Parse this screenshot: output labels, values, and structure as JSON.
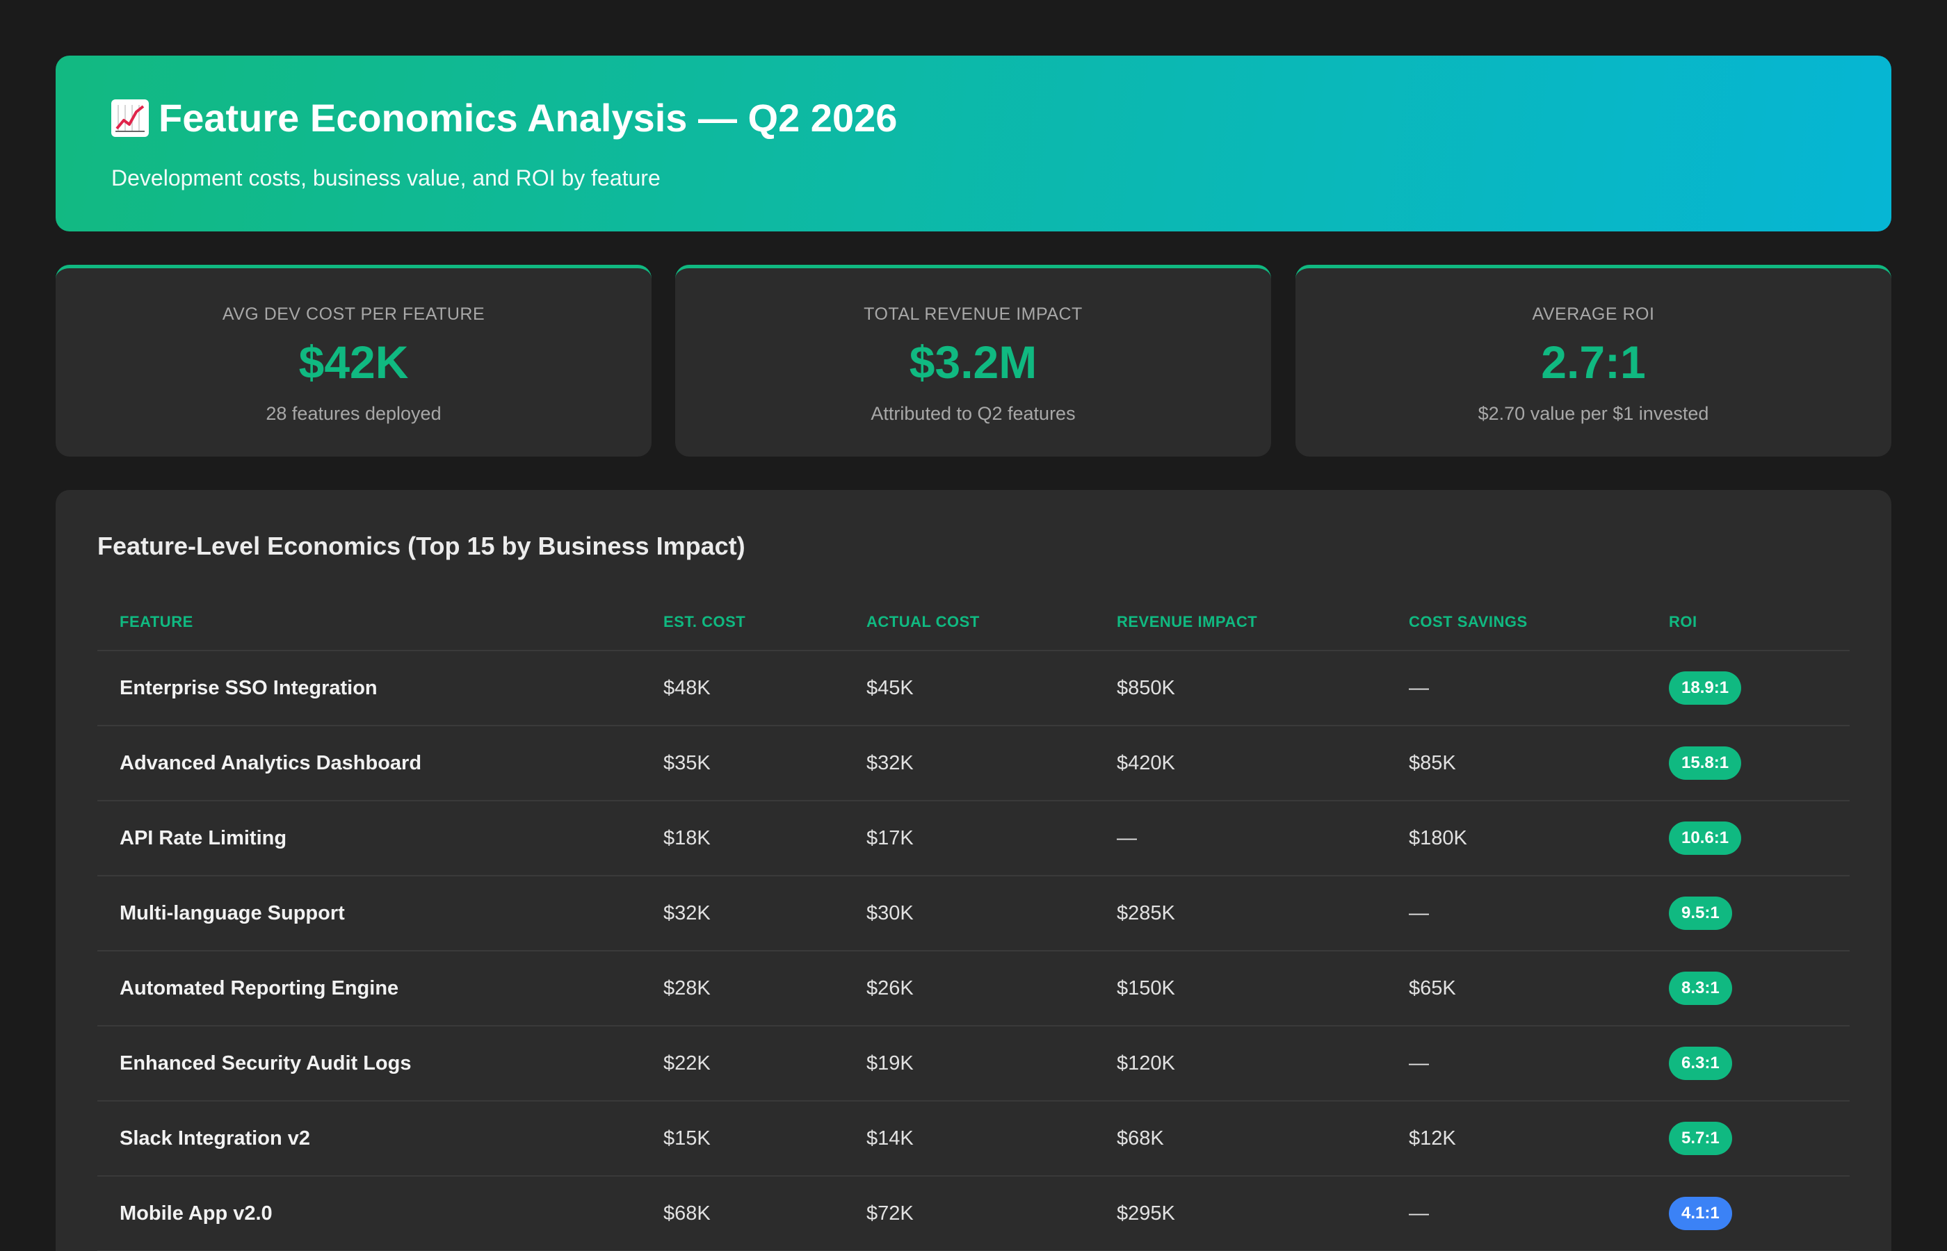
{
  "header": {
    "icon": "chart-increasing-icon",
    "title": "Feature Economics Analysis — Q2 2026",
    "subtitle": "Development costs, business value, and ROI by feature"
  },
  "stats": [
    {
      "label": "AVG DEV COST PER FEATURE",
      "value": "$42K",
      "note": "28 features deployed"
    },
    {
      "label": "TOTAL REVENUE IMPACT",
      "value": "$3.2M",
      "note": "Attributed to Q2 features"
    },
    {
      "label": "AVERAGE ROI",
      "value": "2.7:1",
      "note": "$2.70 value per $1 invested"
    }
  ],
  "table": {
    "title": "Feature-Level Economics (Top 15 by Business Impact)",
    "columns": [
      "FEATURE",
      "EST. COST",
      "ACTUAL COST",
      "REVENUE IMPACT",
      "COST SAVINGS",
      "ROI"
    ],
    "rows": [
      {
        "feature": "Enterprise SSO Integration",
        "est": "$48K",
        "actual": "$45K",
        "revenue": "$850K",
        "savings": "—",
        "roi": "18.9:1",
        "roi_color": "#10b981"
      },
      {
        "feature": "Advanced Analytics Dashboard",
        "est": "$35K",
        "actual": "$32K",
        "revenue": "$420K",
        "savings": "$85K",
        "roi": "15.8:1",
        "roi_color": "#10b981"
      },
      {
        "feature": "API Rate Limiting",
        "est": "$18K",
        "actual": "$17K",
        "revenue": "—",
        "savings": "$180K",
        "roi": "10.6:1",
        "roi_color": "#10b981"
      },
      {
        "feature": "Multi-language Support",
        "est": "$32K",
        "actual": "$30K",
        "revenue": "$285K",
        "savings": "—",
        "roi": "9.5:1",
        "roi_color": "#10b981"
      },
      {
        "feature": "Automated Reporting Engine",
        "est": "$28K",
        "actual": "$26K",
        "revenue": "$150K",
        "savings": "$65K",
        "roi": "8.3:1",
        "roi_color": "#10b981"
      },
      {
        "feature": "Enhanced Security Audit Logs",
        "est": "$22K",
        "actual": "$19K",
        "revenue": "$120K",
        "savings": "—",
        "roi": "6.3:1",
        "roi_color": "#10b981"
      },
      {
        "feature": "Slack Integration v2",
        "est": "$15K",
        "actual": "$14K",
        "revenue": "$68K",
        "savings": "$12K",
        "roi": "5.7:1",
        "roi_color": "#10b981"
      },
      {
        "feature": "Mobile App v2.0",
        "est": "$68K",
        "actual": "$72K",
        "revenue": "$295K",
        "savings": "—",
        "roi": "4.1:1",
        "roi_color": "#3b82f6"
      }
    ]
  }
}
